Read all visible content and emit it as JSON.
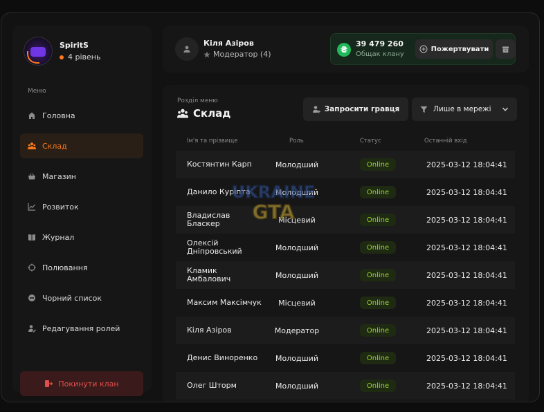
{
  "profile": {
    "username": "SpiritS",
    "level": "4 рівень"
  },
  "menu": {
    "caption": "Меню",
    "items": [
      {
        "label": "Головна",
        "icon": "home-icon"
      },
      {
        "label": "Склад",
        "icon": "members-icon",
        "active": true
      },
      {
        "label": "Магазин",
        "icon": "basket-icon"
      },
      {
        "label": "Розвиток",
        "icon": "chart-icon"
      },
      {
        "label": "Журнал",
        "icon": "book-icon"
      },
      {
        "label": "Полювання",
        "icon": "crosshair-icon"
      },
      {
        "label": "Чорний список",
        "icon": "block-icon"
      },
      {
        "label": "Редагування ролей",
        "icon": "user-edit-icon"
      }
    ],
    "leave": "Покинути клан"
  },
  "header": {
    "name": "Кіля Азіров",
    "role": "Модератор (4)",
    "bank_amount": "39 479 260",
    "bank_label": "Общак клану",
    "coin_symbol": "₴",
    "donate": "Пожертвувати"
  },
  "section": {
    "caption": "Розділ меню",
    "title": "Склад",
    "invite": "Запросити гравця",
    "filter": "Лише в мережі"
  },
  "table": {
    "columns": [
      "Ім'я та прізвище",
      "Роль",
      "Статус",
      "Останній вхід"
    ],
    "rows": [
      {
        "name": "Костянтин Карп",
        "role": "Молодший",
        "status": "Online",
        "last": "2025-03-12 18:04:41"
      },
      {
        "name": "Данило Куріпта",
        "role": "Молодший",
        "status": "Online",
        "last": "2025-03-12 18:04:41"
      },
      {
        "name": "Владислав Бласкер",
        "role": "Місцевий",
        "status": "Online",
        "last": "2025-03-12 18:04:41"
      },
      {
        "name": "Олексій Дніпровський",
        "role": "Молодший",
        "status": "Online",
        "last": "2025-03-12 18:04:41"
      },
      {
        "name": "Кламик Амбалович",
        "role": "Молодший",
        "status": "Online",
        "last": "2025-03-12 18:04:41"
      },
      {
        "name": "Максим Максімчук",
        "role": "Місцевий",
        "status": "Online",
        "last": "2025-03-12 18:04:41"
      },
      {
        "name": "Кіля Азіров",
        "role": "Модератор",
        "status": "Online",
        "last": "2025-03-12 18:04:41"
      },
      {
        "name": "Денис Виноренко",
        "role": "Молодший",
        "status": "Online",
        "last": "2025-03-12 18:04:41"
      },
      {
        "name": "Олег Шторм",
        "role": "Молодший",
        "status": "Online",
        "last": "2025-03-12 18:04:41"
      }
    ]
  },
  "colors": {
    "accent": "#ff7a1a",
    "online": "#9ad631",
    "danger": "#e0504d",
    "money": "#1fb85a"
  }
}
